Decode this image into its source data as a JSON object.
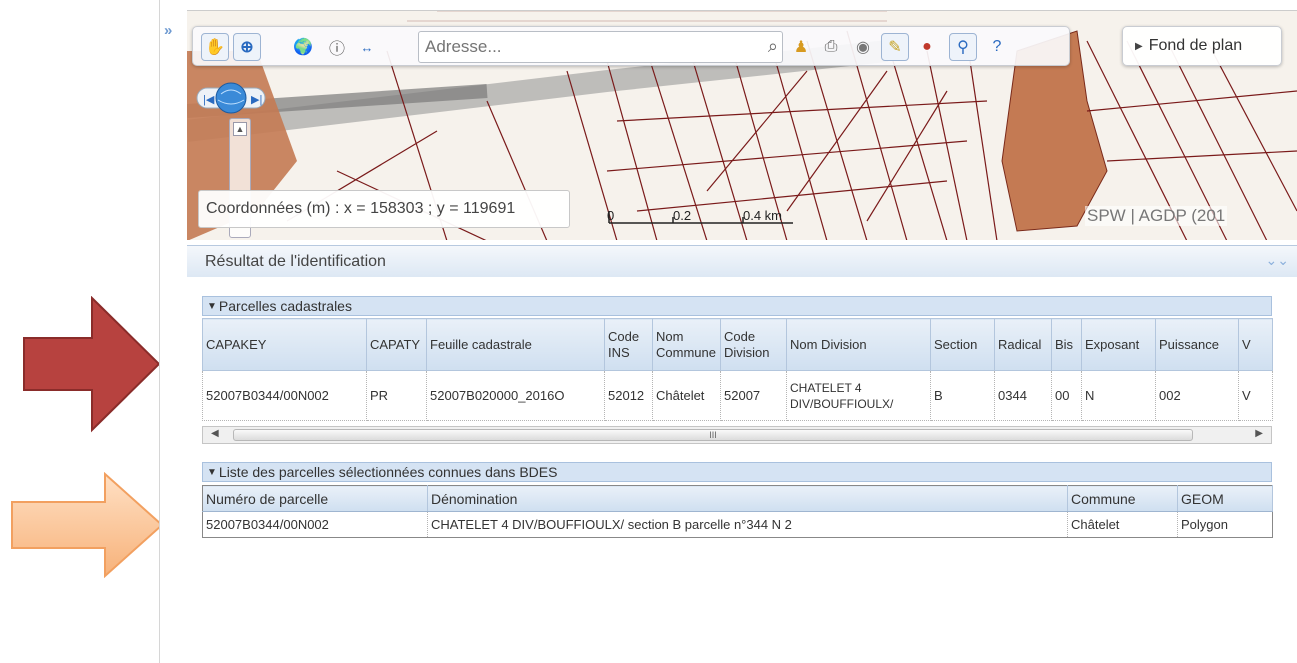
{
  "toolbar": {
    "search_placeholder": "Adresse...",
    "fond_label": "Fond de plan",
    "icons": [
      "pan-hand-icon",
      "zoom-in-icon",
      "globe-icon",
      "info-icon",
      "measure-icon",
      "search-icon",
      "pin-icon",
      "print-icon",
      "layers-icon",
      "draw-icon",
      "overlay-icon",
      "identify-icon",
      "help-icon"
    ]
  },
  "map": {
    "coordinates": "Coordonnées (m) : x = 158303 ; y = 119691",
    "scale_labels": [
      "0",
      "0.2",
      "0.4 km"
    ],
    "attribution": "SPW | AGDP (201"
  },
  "result": {
    "title": "Résultat de l'identification",
    "section1": {
      "title": "Parcelles cadastrales",
      "columns": [
        "CAPAKEY",
        "CAPATY",
        "Feuille cadastrale",
        "Code INS",
        "Nom Commune",
        "Code Division",
        "Nom Division",
        "Section",
        "Radical",
        "Bis",
        "Exposant",
        "Puissance",
        "V"
      ],
      "rows": [
        [
          "52007B0344/00N002",
          "PR",
          "52007B020000_2016O",
          "52012",
          "Châtelet",
          "52007",
          "CHATELET 4 DIV/BOUFFIOULX/",
          "B",
          "0344",
          "00",
          "N",
          "002",
          "V"
        ]
      ],
      "scroll_grip": "III"
    },
    "section2": {
      "title": "Liste des parcelles sélectionnées connues dans BDES",
      "columns": [
        "Numéro de parcelle",
        "Dénomination",
        "Commune",
        "GEOM"
      ],
      "rows": [
        [
          "52007B0344/00N002",
          "CHATELET 4 DIV/BOUFFIOULX/ section B parcelle n°344 N 2",
          "Châtelet",
          "Polygon"
        ]
      ]
    }
  },
  "colors": {
    "red_arrow": "#b7423f",
    "orange_arrow": "#fbc08f",
    "parcel_fill": "#c47a53",
    "accent": "#d5e3f3"
  }
}
